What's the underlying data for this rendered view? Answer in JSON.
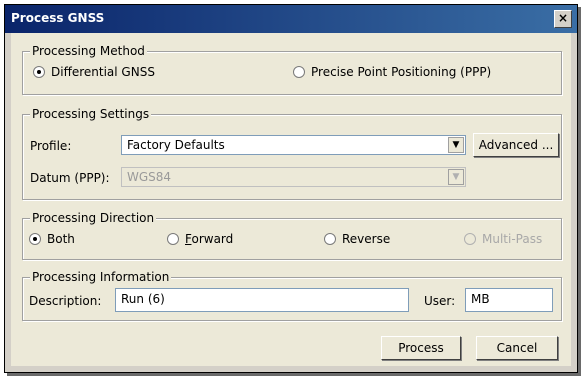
{
  "window": {
    "title": "Process GNSS",
    "close_symbol": "×"
  },
  "processing_method": {
    "legend": "Processing Method",
    "options": [
      {
        "label": "Differential GNSS",
        "selected": true
      },
      {
        "label": "Precise Point Positioning (PPP)",
        "selected": false
      }
    ]
  },
  "processing_settings": {
    "legend": "Processing Settings",
    "profile_label": "Profile:",
    "profile_value": "Factory Defaults",
    "advanced_button": "Advanced ...",
    "datum_label": "Datum (PPP):",
    "datum_value": "WGS84"
  },
  "processing_direction": {
    "legend": "Processing Direction",
    "both": "Both",
    "forward_key": "F",
    "forward_rest": "orward",
    "reverse": "Reverse",
    "multipass": "Multi-Pass",
    "selected": "Both"
  },
  "processing_information": {
    "legend": "Processing Information",
    "description_label": "Description:",
    "description_value": "Run (6)",
    "user_label": "User:",
    "user_value": "MB"
  },
  "buttons": {
    "process": "Process",
    "cancel": "Cancel"
  },
  "icons": {
    "combo_arrow": "dropdown-arrow-icon"
  }
}
